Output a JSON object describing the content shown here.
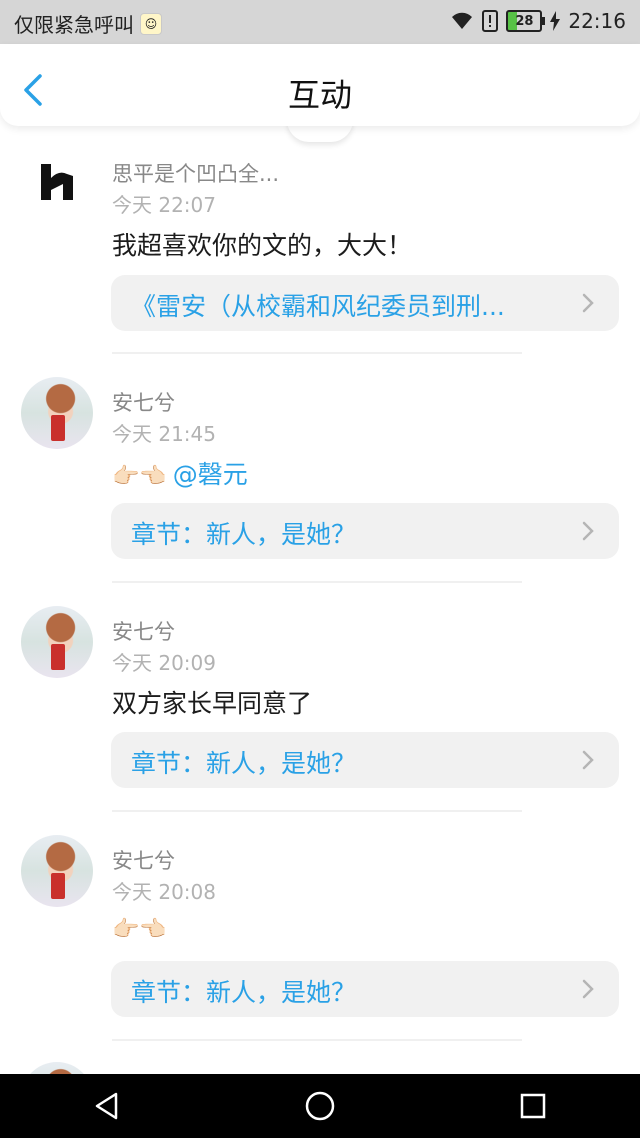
{
  "status_bar": {
    "carrier": "仅限紧急呼叫",
    "battery": "28",
    "time": "22:16"
  },
  "header": {
    "title": "互动"
  },
  "colors": {
    "accent": "#2aa1e6",
    "status_bar_bg": "#d6d6d6",
    "nav_bar_bg": "#000000"
  },
  "feed": [
    {
      "avatar": "h-logo",
      "username": "思平是个凹凸全...",
      "time": "今天 22:07",
      "message": "我超喜欢你的文的，大大！",
      "reference": "《雷安（从校霸和风纪委员到刑..."
    },
    {
      "avatar": "anime-boy",
      "username": "安七兮",
      "time": "今天 21:45",
      "message_hands": "👉🏻👈🏻",
      "message_mention": "@磬元",
      "reference": "章节：新人，是她？"
    },
    {
      "avatar": "anime-boy",
      "username": "安七兮",
      "time": "今天 20:09",
      "message": "双方家长早同意了",
      "reference": "章节：新人，是她？"
    },
    {
      "avatar": "anime-boy",
      "username": "安七兮",
      "time": "今天 20:08",
      "message_hands": "👉🏻👈🏻",
      "reference": "章节：新人，是她？"
    }
  ]
}
